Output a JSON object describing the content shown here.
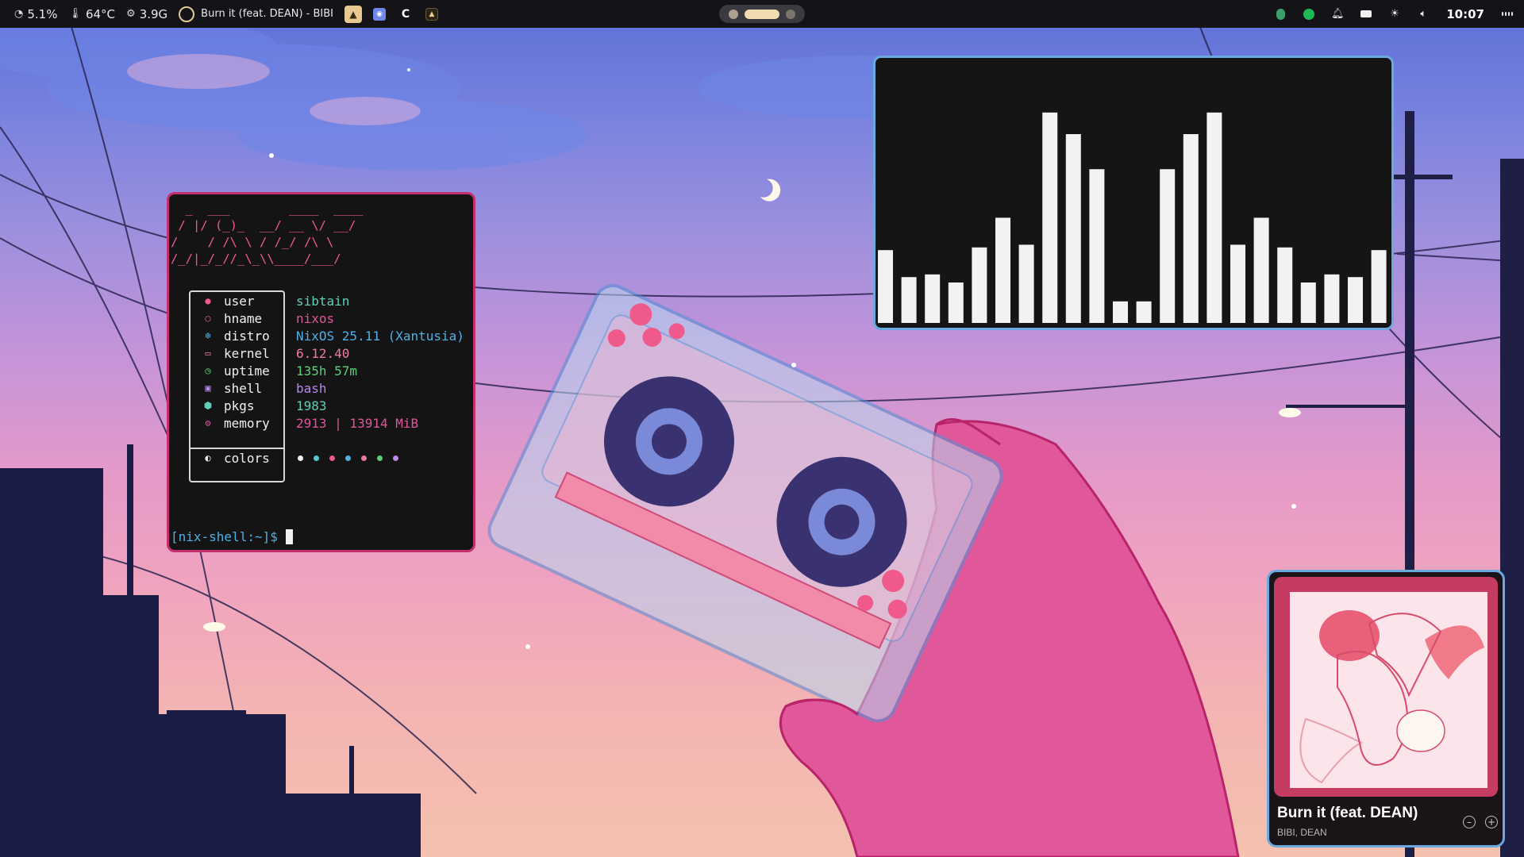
{
  "topbar": {
    "cpu": "5.1%",
    "temperature": "64°C",
    "memory": "3.9G",
    "now_playing": "Burn it (feat. DEAN) - BIBI",
    "app_c_label": "C",
    "clock": "10:07"
  },
  "terminal": {
    "ascii_logo": "  _  ___        ____  ____\n / |/ (_)_  __/ __ \\/ __/\n/    / /\\ \\ / /_/ /\\ \\\n/_/|_/_//_\\_\\\\____/___/",
    "rows": [
      {
        "icon": "user-icon",
        "key": "user",
        "value": "sibtain",
        "color": "#5fd0b8"
      },
      {
        "icon": "host-icon",
        "key": "hname",
        "value": "nixos",
        "color": "#e0569a"
      },
      {
        "icon": "distro-icon",
        "key": "distro",
        "value": "NixOS 25.11 (Xantusia)",
        "color": "#4eb0e8"
      },
      {
        "icon": "laptop-icon",
        "key": "kernel",
        "value": "6.12.40",
        "color": "#f07a9a"
      },
      {
        "icon": "clock-icon",
        "key": "uptime",
        "value": "135h 57m",
        "color": "#5ccf7a"
      },
      {
        "icon": "terminal-icon",
        "key": "shell",
        "value": "bash",
        "color": "#b68ae6"
      },
      {
        "icon": "package-icon",
        "key": "pkgs",
        "value": "1983",
        "color": "#5fd0b8"
      },
      {
        "icon": "memory-icon",
        "key": "memory",
        "value": "2913 | 13914 MiB",
        "color": "#e0569a"
      }
    ],
    "colors_label": "colors",
    "palette": [
      "#f0f0f0",
      "#4ec9d8",
      "#f05a8a",
      "#4eb0e8",
      "#e87aa8",
      "#5ccf7a",
      "#b68ae6"
    ],
    "prompt": "[nix-shell:~]$"
  },
  "visualizer": {
    "levels": [
      0.27,
      0.17,
      0.18,
      0.15,
      0.28,
      0.39,
      0.29,
      0.78,
      0.7,
      0.57,
      0.08,
      0.08,
      0.57,
      0.7,
      0.78,
      0.29,
      0.39,
      0.28,
      0.15,
      0.18,
      0.17,
      0.27
    ]
  },
  "music": {
    "title": "Burn it (feat. DEAN)",
    "artist": "BIBI, DEAN",
    "accent": "#c53c63"
  },
  "colors": {
    "terminal_border": "#c4306e",
    "visualizer_border": "#6aa8e0",
    "bar_bg": "#141418"
  }
}
